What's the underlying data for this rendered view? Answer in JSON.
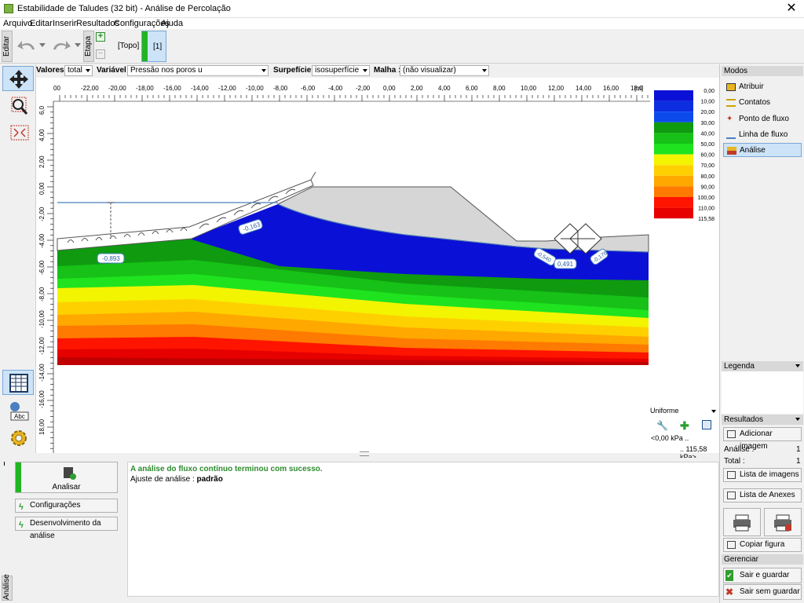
{
  "window": {
    "title": "Estabilidade de Taludes (32 bit) - Análise de Percolação",
    "close": "✕"
  },
  "menu": [
    "Arquivo",
    "Editar",
    "Inserir",
    "Resultados",
    "Configurações",
    "Ajuda"
  ],
  "toolbar": {
    "editar_label": "Editar",
    "etapa_label": "Etapa",
    "stage_topo": "[Topo]",
    "stage_current": "[1]"
  },
  "filters": {
    "valores_label": "Valores :",
    "valores_value": "total",
    "variavel_label": "Variável :",
    "variavel_value": "Pressão nos poros u",
    "superficie_label": "Surpefície :",
    "superficie_value": "isosuperfície",
    "malha_label": "Malha :",
    "malha_value": "(não visualizar)"
  },
  "ruler": {
    "x_labels": [
      "00",
      "-22,00",
      "-20,00",
      "-18,00",
      "-16,00",
      "-14,00",
      "-12,00",
      "-10,00",
      "-8,00",
      "-6,00",
      "-4,00",
      "-2,00",
      "0,00",
      "2,00",
      "4,00",
      "6,00",
      "8,00",
      "10,00",
      "12,00",
      "14,00",
      "16,00",
      "18,0"
    ],
    "x_unit": "[m]",
    "y_labels": [
      "6,0",
      "4,00",
      "2,00",
      "0,00",
      "-2,00",
      "-4,00",
      "-6,00",
      "-8,00",
      "-10,00",
      "-12,00",
      "-14,00",
      "-16,00",
      "18,00"
    ]
  },
  "legend_scale": {
    "values": [
      "0,00",
      "10,00",
      "20,00",
      "30,00",
      "40,00",
      "50,00",
      "60,00",
      "70,00",
      "80,00",
      "90,00",
      "100,00",
      "110,00",
      "115,58"
    ],
    "colors": [
      "#0b10d6",
      "#0c2ee0",
      "#0d4aec",
      "#0f9a10",
      "#17c117",
      "#1fe31f",
      "#f3f400",
      "#ffd000",
      "#ffa800",
      "#ff7a00",
      "#ff1400",
      "#e60000",
      "#c00000"
    ],
    "mode": "Uniforme",
    "min": "<0,00 kPa ..",
    "max": ".. 115,58 kPa>"
  },
  "section_labels": [
    "-0,893",
    "-0,163",
    "-0,540",
    "0,491",
    "-0,176"
  ],
  "right_panel": {
    "modos_title": "Modos",
    "modes": [
      "Atribuir",
      "Contatos",
      "Ponto de fluxo",
      "Linha de fluxo",
      "Análise"
    ],
    "legenda_title": "Legenda",
    "resultados_title": "Resultados",
    "add_image": "Adicionar imagem",
    "analise_label": "Análise :",
    "analise_count": "1",
    "total_label": "Total :",
    "total_count": "1",
    "lista_imagens": "Lista de imagens",
    "lista_anexes": "Lista de Anexes",
    "copiar_figura": "Copiar figura",
    "gerenciar_title": "Gerenciar",
    "sair_guardar": "Sair e guardar",
    "sair_sem_guardar": "Sair sem guardar"
  },
  "bottom": {
    "analisar": "Analisar",
    "configuracoes": "Configurações",
    "desenvolvimento": "Desenvolvimento da análise",
    "side_label": "Análise",
    "msg_success": "A análise do fluxo contínuo terminou com sucesso.",
    "msg_ajuste_label": "Ajuste de análise :",
    "msg_ajuste_value": "padrão"
  }
}
